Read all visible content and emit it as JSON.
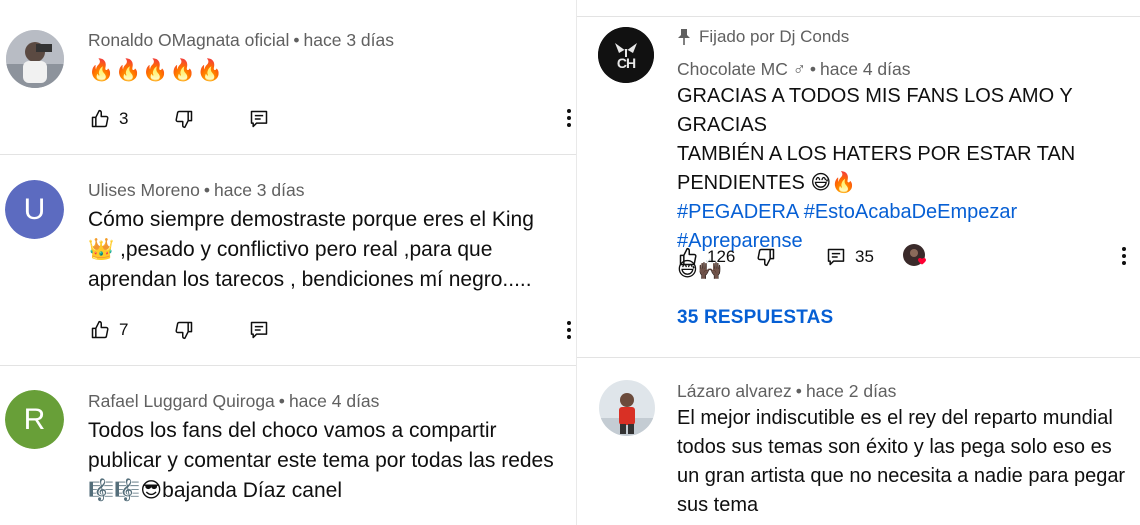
{
  "left_panel": {
    "comments": [
      {
        "author": "Ronaldo OMagnata oficial",
        "time": "hace 3 días",
        "text": "🔥🔥🔥🔥🔥",
        "likes": "3",
        "avatar_icon": "profile-photo-icon"
      },
      {
        "author": "Ulises Moreno",
        "time": "hace 3 días",
        "text_lines": [
          "Cómo siempre demostraste porque eres el King",
          "👑 ,pesado y conflictivo pero real ,para que",
          "aprendan los tarecos , bendiciones mí negro....."
        ],
        "likes": "7",
        "avatar_letter": "U",
        "avatar_color": "#5c6bc0"
      },
      {
        "author": "Rafael Luggard Quiroga",
        "time": "hace 4 días",
        "text_lines": [
          "Todos los fans del choco vamos a compartir",
          "publicar y comentar este tema por todas las redes",
          "🎼🎼😎bajanda Díaz canel"
        ],
        "avatar_letter": "R",
        "avatar_color": "#689f38"
      }
    ]
  },
  "right_panel": {
    "pinned": {
      "pinned_label": "Fijado por Dj Conds",
      "author": "Chocolate MC ♂",
      "time": "hace 4 días",
      "text_lines": [
        "GRACIAS A TODOS MIS FANS LOS AMO Y GRACIAS",
        "TAMBIÉN A LOS HATERS POR ESTAR TAN",
        "PENDIENTES 😅🔥"
      ],
      "hashtags": "#PEGADERA #EstoAcabaDeEmpezar #Apreparense",
      "tail_emoji": "😅🙌🏿",
      "likes": "126",
      "replies_count": "35",
      "replies_label": "35 RESPUESTAS",
      "avatar_text": "CH"
    },
    "comment": {
      "author": "Lázaro alvarez",
      "time": "hace 2 días",
      "text_lines": [
        "El mejor indiscutible es el rey del reparto mundial",
        "todos sus temas son éxito y las pega solo eso es",
        "un gran artista que no necesita a nadie para pegar",
        "sus tema"
      ]
    }
  },
  "colors": {
    "link_blue": "#065fd4",
    "meta_gray": "#606060",
    "text": "#0f0f0f"
  }
}
